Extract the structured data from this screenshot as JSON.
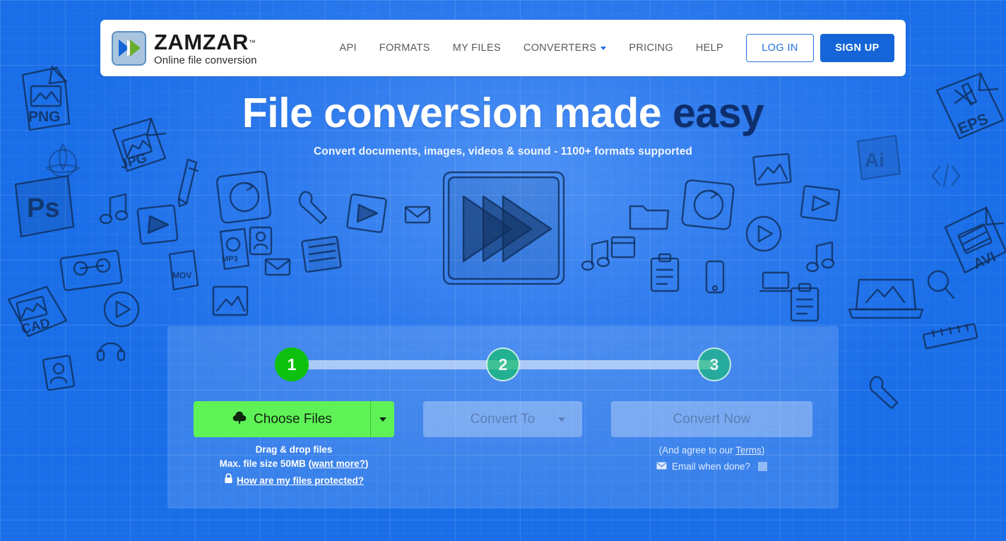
{
  "brand": {
    "name": "ZAMZAR",
    "trademark": "™",
    "tagline": "Online file conversion",
    "logo_icon": "double-chevron-play-icon",
    "colors": {
      "background_blue": "#1a6ee8",
      "signup_blue": "#1565d8",
      "link_blue": "#1f6fe0",
      "choose_green": "#5ef256",
      "step_active_green": "#0ec10e",
      "headline_accent": "#0d2f6e"
    }
  },
  "nav": {
    "items": [
      {
        "label": "API",
        "has_caret": false
      },
      {
        "label": "FORMATS",
        "has_caret": false
      },
      {
        "label": "MY FILES",
        "has_caret": false
      },
      {
        "label": "CONVERTERS",
        "has_caret": true
      },
      {
        "label": "PRICING",
        "has_caret": false
      },
      {
        "label": "HELP",
        "has_caret": false
      }
    ],
    "login_label": "LOG IN",
    "signup_label": "SIGN UP"
  },
  "hero": {
    "title_main": "File conversion made ",
    "title_accent": "easy",
    "subtitle": "Convert documents, images, videos & sound - 1100+ formats supported",
    "center_illustration": "fast-forward-play-sketch-icon"
  },
  "panel": {
    "steps": [
      {
        "number": "1",
        "state": "active"
      },
      {
        "number": "2",
        "state": "pending"
      },
      {
        "number": "3",
        "state": "pending"
      }
    ],
    "choose_files_label": "Choose Files",
    "choose_files_icon": "cloud-upload-icon",
    "choose_files_caret_icon": "caret-down-icon",
    "convert_to_label": "Convert To",
    "convert_to_caret_icon": "caret-down-icon",
    "convert_now_label": "Convert Now",
    "left_help": {
      "line1": "Drag & drop files",
      "line2_prefix": "Max. file size 50MB (",
      "line2_link": "want more?",
      "line2_suffix": ")",
      "lock_icon": "lock-icon",
      "protected_link": "How are my files protected?"
    },
    "right_help": {
      "terms_prefix": "(And agree to our ",
      "terms_link": "Terms",
      "terms_suffix": ")",
      "email_icon": "envelope-icon",
      "email_label": "Email when done?",
      "email_checked": false
    }
  },
  "doodles": {
    "labels": [
      "PNG",
      "JPG",
      "PS",
      "CAD",
      "EPS",
      "Ai",
      "AVI"
    ]
  }
}
